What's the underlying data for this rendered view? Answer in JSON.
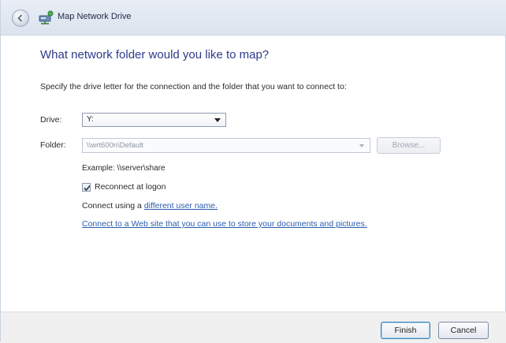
{
  "window": {
    "title": "Map Network Drive",
    "back_icon": "back-arrow-icon",
    "app_icon": "network-drive-icon"
  },
  "main": {
    "heading": "What network folder would you like to map?",
    "instructions": "Specify the drive letter for the connection and the folder that you want to connect to:",
    "drive": {
      "label": "Drive:",
      "value": "Y:"
    },
    "folder": {
      "label": "Folder:",
      "value": "\\\\wrt600n\\Default"
    },
    "browse_label": "Browse...",
    "example": "Example: \\\\server\\share",
    "reconnect": {
      "label": "Reconnect at logon",
      "checked": true
    },
    "connect_using_prefix": "Connect using a ",
    "connect_using_link": "different user name.",
    "web_link": "Connect to a Web site that you can use to store your documents and pictures."
  },
  "footer": {
    "finish_label": "Finish",
    "cancel_label": "Cancel"
  },
  "colors": {
    "heading": "#2e3a8c",
    "link": "#2a5db0",
    "titlebar": "#dbe3ee"
  }
}
